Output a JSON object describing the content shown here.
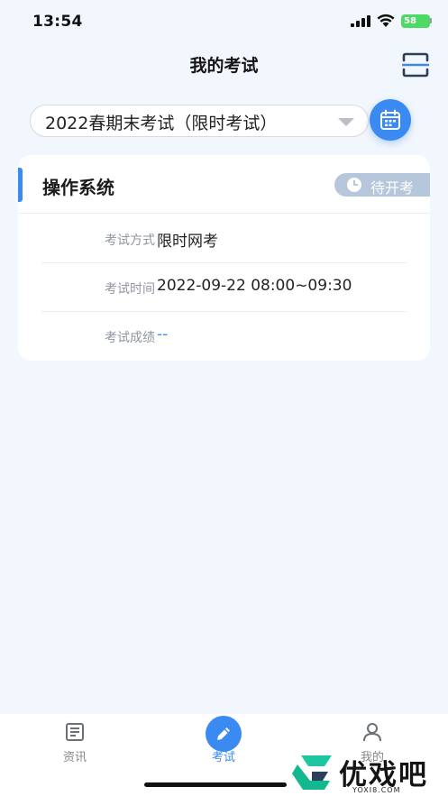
{
  "status_bar": {
    "time": "13:54",
    "battery": "58"
  },
  "header": {
    "title": "我的考试"
  },
  "exam_selector": {
    "value": "2022春期末考试（限时考试）"
  },
  "card": {
    "title": "操作系统",
    "status": "待开考",
    "rows": [
      {
        "label": "考试方式",
        "value": "限时网考"
      },
      {
        "label": "考试时间",
        "value": "2022-09-22 08:00~09:30"
      },
      {
        "label": "考试成绩",
        "value": "--"
      }
    ]
  },
  "tabs": [
    {
      "label": "资讯",
      "icon": "news-icon",
      "active": false
    },
    {
      "label": "考试",
      "icon": "pencil-icon",
      "active": true
    },
    {
      "label": "我的",
      "icon": "person-icon",
      "active": false
    }
  ],
  "watermark": {
    "text": "优戏吧",
    "sub": "YOXI8.COM"
  },
  "colors": {
    "accent": "#3b8af2",
    "background": "#f2f6fd",
    "tag": "#b7c7db"
  }
}
